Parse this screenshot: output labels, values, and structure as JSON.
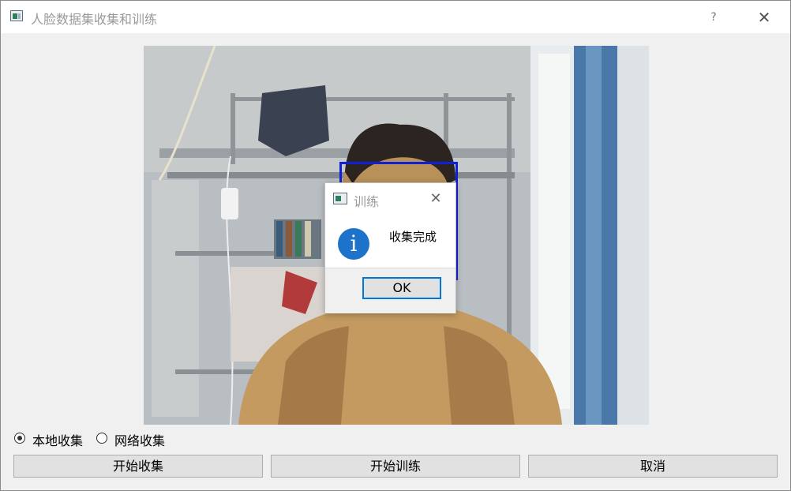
{
  "window": {
    "title": "人脸数据集收集和训练",
    "help_label": "?",
    "close_label": "✕"
  },
  "dialog": {
    "title": "训练",
    "close_label": "✕",
    "icon": "information-icon",
    "icon_glyph": "i",
    "message": "收集完成",
    "ok_label": "OK"
  },
  "collection_mode": {
    "options": [
      {
        "label": "本地收集",
        "checked": true
      },
      {
        "label": "网络收集",
        "checked": false
      }
    ]
  },
  "buttons": {
    "start_collect": "开始收集",
    "start_train": "开始训练",
    "cancel": "取消"
  },
  "colors": {
    "face_box": "#1020d8",
    "accent": "#0078d7",
    "info_icon": "#1d73c9"
  }
}
